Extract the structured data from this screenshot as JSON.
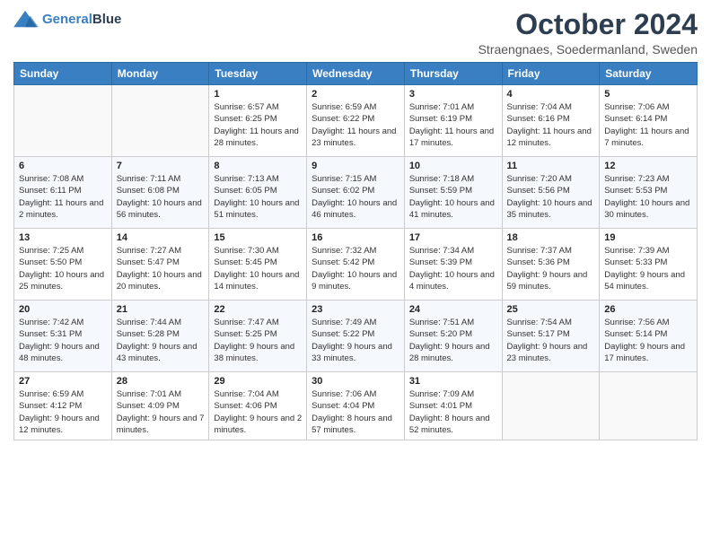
{
  "header": {
    "logo_line1": "General",
    "logo_line2": "Blue",
    "month_title": "October 2024",
    "subtitle": "Straengnaes, Soedermanland, Sweden"
  },
  "days_of_week": [
    "Sunday",
    "Monday",
    "Tuesday",
    "Wednesday",
    "Thursday",
    "Friday",
    "Saturday"
  ],
  "weeks": [
    [
      {
        "day": "",
        "info": ""
      },
      {
        "day": "",
        "info": ""
      },
      {
        "day": "1",
        "info": "Sunrise: 6:57 AM\nSunset: 6:25 PM\nDaylight: 11 hours and 28 minutes."
      },
      {
        "day": "2",
        "info": "Sunrise: 6:59 AM\nSunset: 6:22 PM\nDaylight: 11 hours and 23 minutes."
      },
      {
        "day": "3",
        "info": "Sunrise: 7:01 AM\nSunset: 6:19 PM\nDaylight: 11 hours and 17 minutes."
      },
      {
        "day": "4",
        "info": "Sunrise: 7:04 AM\nSunset: 6:16 PM\nDaylight: 11 hours and 12 minutes."
      },
      {
        "day": "5",
        "info": "Sunrise: 7:06 AM\nSunset: 6:14 PM\nDaylight: 11 hours and 7 minutes."
      }
    ],
    [
      {
        "day": "6",
        "info": "Sunrise: 7:08 AM\nSunset: 6:11 PM\nDaylight: 11 hours and 2 minutes."
      },
      {
        "day": "7",
        "info": "Sunrise: 7:11 AM\nSunset: 6:08 PM\nDaylight: 10 hours and 56 minutes."
      },
      {
        "day": "8",
        "info": "Sunrise: 7:13 AM\nSunset: 6:05 PM\nDaylight: 10 hours and 51 minutes."
      },
      {
        "day": "9",
        "info": "Sunrise: 7:15 AM\nSunset: 6:02 PM\nDaylight: 10 hours and 46 minutes."
      },
      {
        "day": "10",
        "info": "Sunrise: 7:18 AM\nSunset: 5:59 PM\nDaylight: 10 hours and 41 minutes."
      },
      {
        "day": "11",
        "info": "Sunrise: 7:20 AM\nSunset: 5:56 PM\nDaylight: 10 hours and 35 minutes."
      },
      {
        "day": "12",
        "info": "Sunrise: 7:23 AM\nSunset: 5:53 PM\nDaylight: 10 hours and 30 minutes."
      }
    ],
    [
      {
        "day": "13",
        "info": "Sunrise: 7:25 AM\nSunset: 5:50 PM\nDaylight: 10 hours and 25 minutes."
      },
      {
        "day": "14",
        "info": "Sunrise: 7:27 AM\nSunset: 5:47 PM\nDaylight: 10 hours and 20 minutes."
      },
      {
        "day": "15",
        "info": "Sunrise: 7:30 AM\nSunset: 5:45 PM\nDaylight: 10 hours and 14 minutes."
      },
      {
        "day": "16",
        "info": "Sunrise: 7:32 AM\nSunset: 5:42 PM\nDaylight: 10 hours and 9 minutes."
      },
      {
        "day": "17",
        "info": "Sunrise: 7:34 AM\nSunset: 5:39 PM\nDaylight: 10 hours and 4 minutes."
      },
      {
        "day": "18",
        "info": "Sunrise: 7:37 AM\nSunset: 5:36 PM\nDaylight: 9 hours and 59 minutes."
      },
      {
        "day": "19",
        "info": "Sunrise: 7:39 AM\nSunset: 5:33 PM\nDaylight: 9 hours and 54 minutes."
      }
    ],
    [
      {
        "day": "20",
        "info": "Sunrise: 7:42 AM\nSunset: 5:31 PM\nDaylight: 9 hours and 48 minutes."
      },
      {
        "day": "21",
        "info": "Sunrise: 7:44 AM\nSunset: 5:28 PM\nDaylight: 9 hours and 43 minutes."
      },
      {
        "day": "22",
        "info": "Sunrise: 7:47 AM\nSunset: 5:25 PM\nDaylight: 9 hours and 38 minutes."
      },
      {
        "day": "23",
        "info": "Sunrise: 7:49 AM\nSunset: 5:22 PM\nDaylight: 9 hours and 33 minutes."
      },
      {
        "day": "24",
        "info": "Sunrise: 7:51 AM\nSunset: 5:20 PM\nDaylight: 9 hours and 28 minutes."
      },
      {
        "day": "25",
        "info": "Sunrise: 7:54 AM\nSunset: 5:17 PM\nDaylight: 9 hours and 23 minutes."
      },
      {
        "day": "26",
        "info": "Sunrise: 7:56 AM\nSunset: 5:14 PM\nDaylight: 9 hours and 17 minutes."
      }
    ],
    [
      {
        "day": "27",
        "info": "Sunrise: 6:59 AM\nSunset: 4:12 PM\nDaylight: 9 hours and 12 minutes."
      },
      {
        "day": "28",
        "info": "Sunrise: 7:01 AM\nSunset: 4:09 PM\nDaylight: 9 hours and 7 minutes."
      },
      {
        "day": "29",
        "info": "Sunrise: 7:04 AM\nSunset: 4:06 PM\nDaylight: 9 hours and 2 minutes."
      },
      {
        "day": "30",
        "info": "Sunrise: 7:06 AM\nSunset: 4:04 PM\nDaylight: 8 hours and 57 minutes."
      },
      {
        "day": "31",
        "info": "Sunrise: 7:09 AM\nSunset: 4:01 PM\nDaylight: 8 hours and 52 minutes."
      },
      {
        "day": "",
        "info": ""
      },
      {
        "day": "",
        "info": ""
      }
    ]
  ]
}
